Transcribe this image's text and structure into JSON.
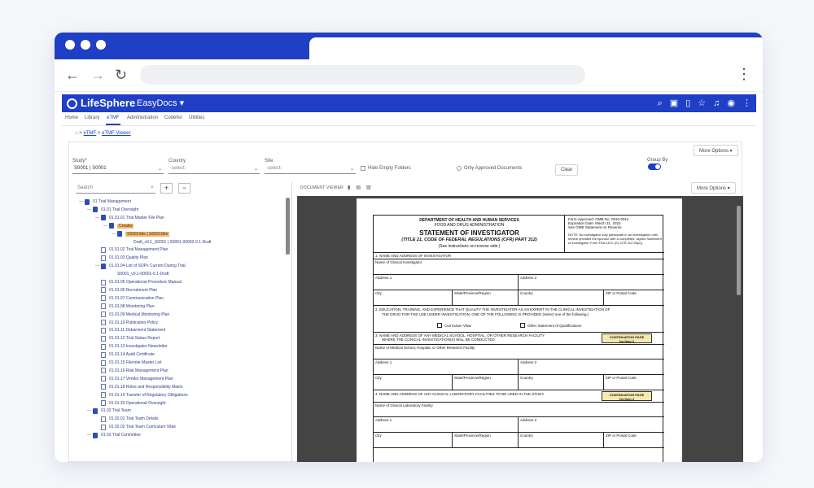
{
  "app": {
    "brand": "LifeSphere",
    "product": "EasyDocs",
    "product_caret": "▾",
    "top_icons": [
      "search-icon",
      "reader-icon",
      "bookmark-icon",
      "star-icon",
      "bell-icon",
      "account-icon",
      "more-icon"
    ]
  },
  "menu": {
    "items": [
      "Home",
      "Library",
      "eTMF",
      "Administration",
      "Codelist",
      "Utilities"
    ],
    "active": "eTMF"
  },
  "breadcrumb": {
    "home_icon": "⌂",
    "items": [
      "eTMF",
      "eTMF Viewer"
    ],
    "sep": ">"
  },
  "toolbar": {
    "more_options": "More Options ▾",
    "more_options_viewer": "More Options ▾",
    "clear": "Clear"
  },
  "filters": {
    "study_label": "Study*",
    "study_value": "S0001 | S0001",
    "country_label": "Country",
    "country_value": "-select-",
    "site_label": "Site",
    "site_value": "-select-",
    "hide_empty": "Hide Empty Folders",
    "only_approved": "Only Approved Documents",
    "group_by": "Group By",
    "caret": "⌄"
  },
  "tree": {
    "search_placeholder": "Search",
    "plus": "+",
    "minus": "−",
    "nodes": [
      {
        "label": "01 Trial Management",
        "depth": 0,
        "type": "folder"
      },
      {
        "label": "01.01 Trial Oversight",
        "depth": 1,
        "type": "folder"
      },
      {
        "label": "01.01.01 Trial Master File Plan",
        "depth": 2,
        "type": "folder"
      },
      {
        "label": "Croatia",
        "depth": 3,
        "type": "folder",
        "hl": true
      },
      {
        "label": "S0001Site | S0001Site",
        "depth": 4,
        "type": "folder",
        "hl": true
      },
      {
        "label": "Draft_v0.1_S0001 | S0001-00002-0.1-Draft",
        "depth": 5,
        "type": "check"
      },
      {
        "label": "01.01.02 Trial Management Plan",
        "depth": 2,
        "type": "doc"
      },
      {
        "label": "01.01.03 Quality Plan",
        "depth": 2,
        "type": "doc"
      },
      {
        "label": "01.01.04 List of SOPs Current During Trial",
        "depth": 2,
        "type": "folder"
      },
      {
        "label": "S0001_v0.1-00001-0.1-Draft",
        "depth": 3,
        "type": "check"
      },
      {
        "label": "01.01.05 Operational Procedure Manual",
        "depth": 2,
        "type": "doc"
      },
      {
        "label": "01.01.06 Recruitment Plan",
        "depth": 2,
        "type": "doc"
      },
      {
        "label": "01.01.07 Communication Plan",
        "depth": 2,
        "type": "doc"
      },
      {
        "label": "01.01.08 Monitoring Plan",
        "depth": 2,
        "type": "doc"
      },
      {
        "label": "01.01.09 Medical Monitoring Plan",
        "depth": 2,
        "type": "doc"
      },
      {
        "label": "01.01.10 Publication Policy",
        "depth": 2,
        "type": "doc"
      },
      {
        "label": "01.01.11 Debarment Statement",
        "depth": 2,
        "type": "doc"
      },
      {
        "label": "01.01.12 Trial Status Report",
        "depth": 2,
        "type": "doc"
      },
      {
        "label": "01.01.13 Investigator Newsletter",
        "depth": 2,
        "type": "doc"
      },
      {
        "label": "01.01.14 Audit Certificate",
        "depth": 2,
        "type": "doc"
      },
      {
        "label": "01.01.15 Filenote Master List",
        "depth": 2,
        "type": "doc"
      },
      {
        "label": "01.01.16 Risk Management Plan",
        "depth": 2,
        "type": "doc"
      },
      {
        "label": "01.01.17 Vendor Management Plan",
        "depth": 2,
        "type": "doc"
      },
      {
        "label": "01.01.18 Roles and Responsibility Matrix",
        "depth": 2,
        "type": "doc"
      },
      {
        "label": "01.01.19 Transfer of Regulatory Obligations",
        "depth": 2,
        "type": "doc"
      },
      {
        "label": "01.01.20 Operational Oversight",
        "depth": 2,
        "type": "doc"
      },
      {
        "label": "01.02 Trial Team",
        "depth": 1,
        "type": "folder"
      },
      {
        "label": "01.02.01 Trial Team Details",
        "depth": 2,
        "type": "doc"
      },
      {
        "label": "01.02.02 Trial Team Curriculum Vitae",
        "depth": 2,
        "type": "doc"
      },
      {
        "label": "01.03 Trial Committee",
        "depth": 1,
        "type": "folder"
      }
    ]
  },
  "viewer": {
    "label": "DOCUMENT VIEWER",
    "icons": [
      "▮",
      "▤",
      "▧"
    ]
  },
  "form": {
    "dept": "DEPARTMENT OF HEALTH AND HUMAN SERVICES",
    "agency": "FOOD AND DRUG ADMINISTRATION",
    "title": "STATEMENT OF INVESTIGATOR",
    "subtitle": "(TITLE 21, CODE OF FEDERAL REGULATIONS (CFR) PART 312)",
    "see": "(See instructions on reverse side.)",
    "approved": "Form Approved: OMB No. 0910-0014",
    "expiration": "Expiration Date: March 31, 2022",
    "omb_stmt": "See OMB Statement on Reverse.",
    "note": "NOTE: No investigator may participate in an investigation until he/she provides the sponsor with a completed, signed Statement of Investigator, Form FDA 1572 (21 CFR 312.53(c)).",
    "s1": "1.  NAME AND ADDRESS OF INVESTIGATOR",
    "name_ci": "Name of Clinical Investigator",
    "address1": "Address 1",
    "address2": "Address 2",
    "city": "City",
    "state": "State/Province/Region",
    "country": "Country",
    "zip": "ZIP or Postal Code",
    "s2": "2.  EDUCATION, TRAINING, AND EXPERIENCE THAT QUALIFY THE INVESTIGATOR AS AN EXPERT IN THE CLINICAL INVESTIGATION OF",
    "s2b": "THE DRUG FOR THE USE UNDER INVESTIGATION. ONE OF THE FOLLOWING IS PROVIDED (Select one of the following.)",
    "cv": "Curriculum Vitae",
    "other_q": "Other Statement of Qualifications",
    "s3": "3.  NAME AND ADDRESS OF ANY MEDICAL SCHOOL, HOSPITAL, OR OTHER RESEARCH FACILITY",
    "s3b": "WHERE THE CLINICAL INVESTIGATION(S) WILL BE CONDUCTED",
    "name_ms": "Name of Medical School, Hospital, or Other Research Facility",
    "cont": "CONTINUATION PAGE",
    "cont3": "for Item 3",
    "cont4": "for Item 4",
    "s4": "4.  NAME AND ADDRESS OF ANY CLINICAL LABORATORY FACILITIES TO BE USED IN THE STUDY",
    "name_lab": "Name of Clinical Laboratory Facility"
  }
}
